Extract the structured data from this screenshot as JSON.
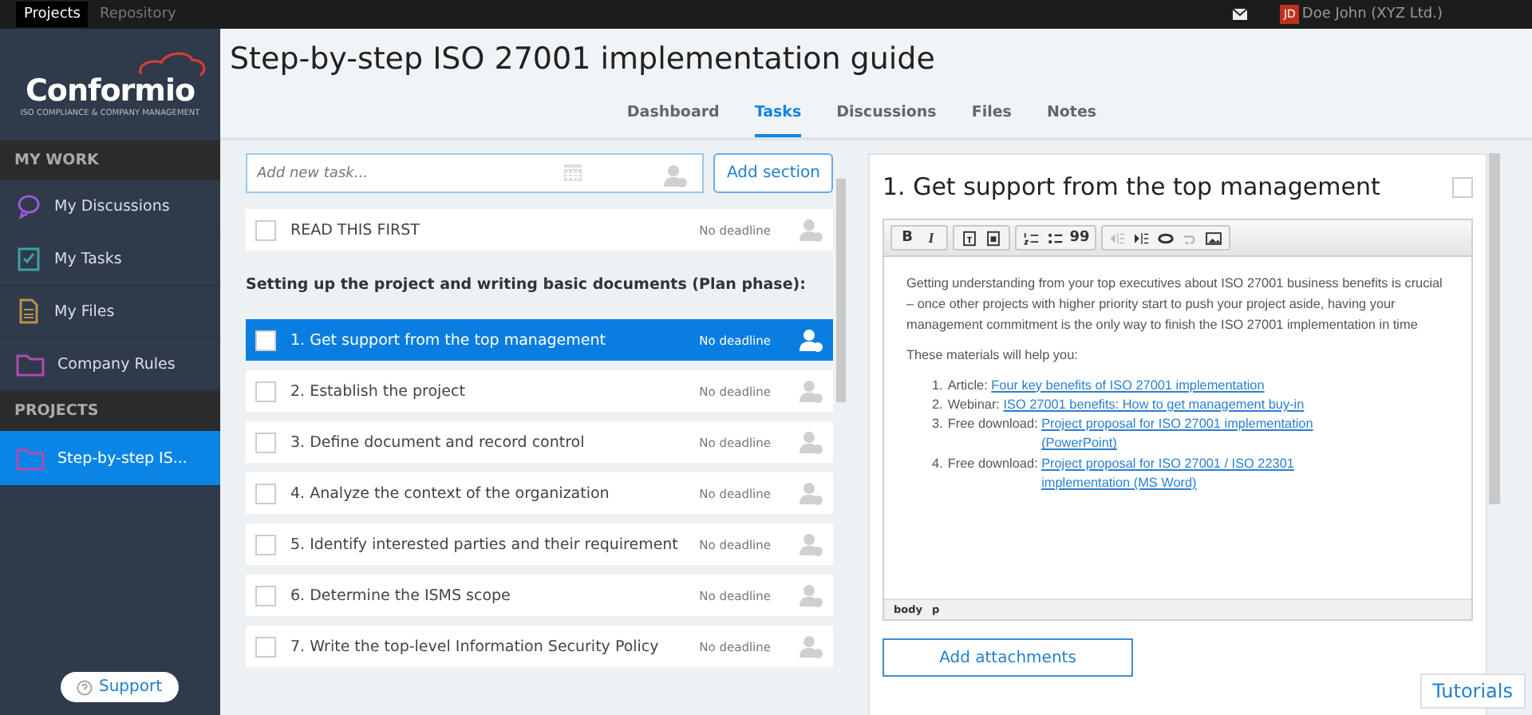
{
  "topbar": {
    "tabs": [
      {
        "label": "Projects",
        "selected": true
      },
      {
        "label": "Repository",
        "selected": false
      }
    ],
    "user_initials": "JD",
    "user_name": "Doe John (XYZ Ltd.)"
  },
  "sidebar": {
    "logo": {
      "name": "Conformio",
      "tagline": "ISO COMPLIANCE & COMPANY MANAGEMENT"
    },
    "sections": [
      {
        "heading": "MY WORK",
        "items": [
          {
            "label": "My Discussions",
            "kind": "chat",
            "selected": false
          },
          {
            "label": "My Tasks",
            "kind": "check",
            "selected": false
          },
          {
            "label": "My Files",
            "kind": "file",
            "selected": false
          },
          {
            "label": "Company Rules",
            "kind": "folder",
            "selected": false
          }
        ]
      },
      {
        "heading": "PROJECTS",
        "items": [
          {
            "label": "Step-by-step IS...",
            "kind": "folder",
            "selected": true
          }
        ]
      }
    ],
    "support": "Support"
  },
  "page": {
    "title": "Step-by-step ISO 27001 implementation guide",
    "tabs": [
      {
        "label": "Dashboard",
        "selected": false
      },
      {
        "label": "Tasks",
        "selected": true
      },
      {
        "label": "Discussions",
        "selected": false
      },
      {
        "label": "Files",
        "selected": false
      },
      {
        "label": "Notes",
        "selected": false
      }
    ]
  },
  "tasks": {
    "placeholder": "Add new task...",
    "add_section": "Add section",
    "items": [
      {
        "kind": "task",
        "label": "READ THIS FIRST",
        "deadline": "No deadline",
        "checked": false,
        "selected": false
      },
      {
        "kind": "heading",
        "label": "Setting up the project and writing basic documents (Plan phase):"
      },
      {
        "kind": "task",
        "label": "1. Get support from the top management",
        "deadline": "No deadline",
        "checked": false,
        "selected": true
      },
      {
        "kind": "task",
        "label": "2. Establish the project",
        "deadline": "No deadline",
        "checked": false,
        "selected": false
      },
      {
        "kind": "task",
        "label": "3. Define document and record control",
        "deadline": "No deadline",
        "checked": false,
        "selected": false
      },
      {
        "kind": "task",
        "label": "4. Analyze the context of the organization",
        "deadline": "No deadline",
        "checked": false,
        "selected": false
      },
      {
        "kind": "task",
        "label": "5. Identify interested parties and their requirement",
        "deadline": "No deadline",
        "checked": false,
        "selected": false
      },
      {
        "kind": "task",
        "label": "6. Determine the ISMS scope",
        "deadline": "No deadline",
        "checked": false,
        "selected": false
      },
      {
        "kind": "task",
        "label": "7. Write the top-level Information Security Policy",
        "deadline": "No deadline",
        "checked": false,
        "selected": false
      }
    ]
  },
  "detail": {
    "title": "1. Get support from the top management",
    "checked": false,
    "toolbar": [
      [
        {
          "kind": "bold",
          "label": "B",
          "disabled": false
        },
        {
          "kind": "italic",
          "label": "I",
          "disabled": false
        }
      ],
      [
        {
          "kind": "paste-text",
          "disabled": false
        },
        {
          "kind": "paste-word",
          "disabled": false
        }
      ],
      [
        {
          "kind": "numbered-list",
          "disabled": false
        },
        {
          "kind": "bulleted-list",
          "disabled": false
        },
        {
          "kind": "quote",
          "label": "99",
          "disabled": false
        }
      ],
      [
        {
          "kind": "outdent",
          "disabled": true
        },
        {
          "kind": "indent",
          "disabled": false
        },
        {
          "kind": "link",
          "disabled": false
        },
        {
          "kind": "unlink",
          "disabled": true
        },
        {
          "kind": "image",
          "disabled": false
        }
      ]
    ],
    "intro": "Getting understanding from your top executives about ISO 27001 business benefits is crucial – once other projects with higher priority start to push your project aside, having your management commitment is the only way to finish the ISO 27001 implementation in time",
    "lead": "These materials will help you:",
    "materials": [
      {
        "number": "1.",
        "prefix": "Article:",
        "link": "Four key benefits of ISO 27001 implementation"
      },
      {
        "number": "2.",
        "prefix": "Webinar:",
        "link": "ISO 27001 benefits: How to get management buy-in"
      },
      {
        "number": "3.",
        "prefix": "Free download:",
        "link": "Project proposal for ISO 27001 implementation (PowerPoint)"
      },
      {
        "number": "4.",
        "prefix": "Free download:",
        "link": "Project proposal for ISO 27001 / ISO 22301 implementation (MS Word)"
      }
    ],
    "path": [
      "body",
      "p"
    ],
    "attach": "Add attachments"
  },
  "tutorials": "Tutorials"
}
